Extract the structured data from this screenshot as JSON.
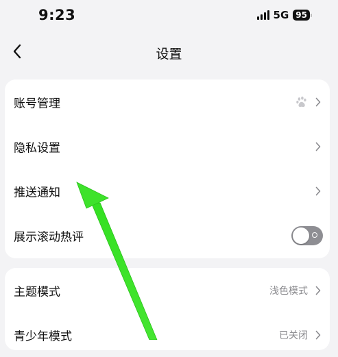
{
  "status_bar": {
    "time": "9:23",
    "network": "5G",
    "battery": "95"
  },
  "nav": {
    "title": "设置",
    "back_icon": "chevron-left-icon"
  },
  "group1": [
    {
      "label": "账号管理",
      "value": "",
      "control": "chevron",
      "extra_icon": "baidu-paw-icon"
    },
    {
      "label": "隐私设置",
      "value": "",
      "control": "chevron"
    },
    {
      "label": "推送通知",
      "value": "",
      "control": "chevron"
    },
    {
      "label": "展示滚动热评",
      "control": "toggle",
      "toggle_on": false
    }
  ],
  "group2": [
    {
      "label": "主题模式",
      "value": "浅色模式",
      "control": "chevron"
    },
    {
      "label": "青少年模式",
      "value": "已关闭",
      "control": "chevron"
    }
  ],
  "colors": {
    "background": "#f3f3f5",
    "card": "#ffffff",
    "secondary_text": "#8a8a8e",
    "toggle_off": "#8e8e93",
    "annotation_arrow": "#3ee22b"
  }
}
